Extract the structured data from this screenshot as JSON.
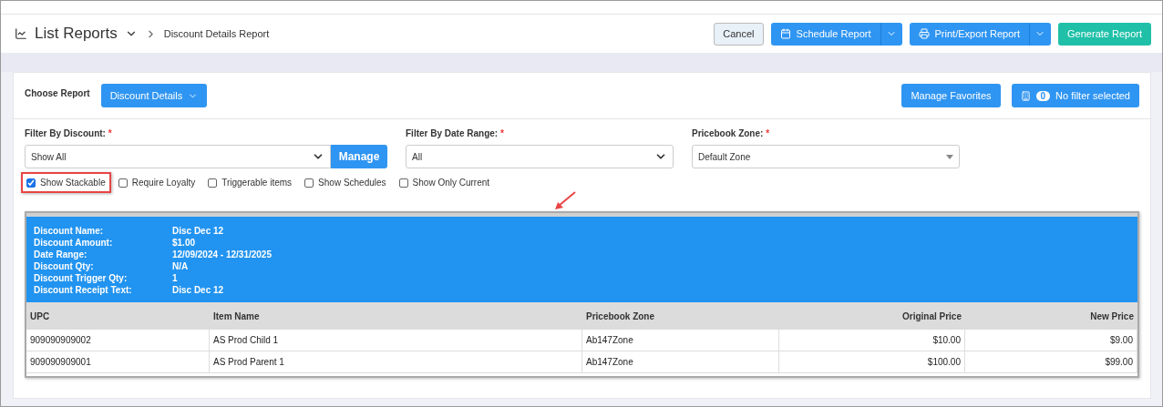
{
  "header": {
    "title": "List Reports",
    "breadcrumb": "Discount Details Report"
  },
  "actions": [
    {
      "label": "Cancel",
      "kind": "plain"
    },
    {
      "label": "Schedule Report",
      "kind": "split"
    },
    {
      "label": "Print/Export Report",
      "kind": "split"
    },
    {
      "label": "Generate Report",
      "kind": "success"
    }
  ],
  "choose_report": {
    "label": "Choose Report",
    "value": "Discount Details"
  },
  "manage_favorites": "Manage Favorites",
  "filter_badge": {
    "count": "0",
    "label": "No filter selected"
  },
  "filters": [
    {
      "label": "Filter By Discount:",
      "required": "*",
      "value": "Show All",
      "kind": "select-manage",
      "button": "Manage"
    },
    {
      "label": "Filter By Date Range:",
      "required": "*",
      "value": "All",
      "kind": "select"
    },
    {
      "label": "Pricebook Zone:",
      "required": "*",
      "value": "Default Zone",
      "kind": "combo"
    }
  ],
  "options": [
    {
      "label": "Show Stackable",
      "checked": true,
      "highlighted": true
    },
    {
      "label": "Require Loyalty",
      "checked": false,
      "highlighted": false
    },
    {
      "label": "Triggerable items",
      "checked": false,
      "highlighted": false
    },
    {
      "label": "Show Schedules",
      "checked": false,
      "highlighted": false
    },
    {
      "label": "Show Only Current",
      "checked": false,
      "highlighted": false
    }
  ],
  "summary": [
    {
      "label": "Discount Name:",
      "value": "Disc Dec 12"
    },
    {
      "label": "Discount Amount:",
      "value": "$1.00"
    },
    {
      "label": "Date Range:",
      "value": "12/09/2024 - 12/31/2025"
    },
    {
      "label": "Discount Qty:",
      "value": "N/A"
    },
    {
      "label": "Discount Trigger Qty:",
      "value": "1"
    },
    {
      "label": "Discount Receipt Text:",
      "value": "Disc Dec 12"
    }
  ],
  "table": {
    "columns": [
      "UPC",
      "Item Name",
      "Pricebook Zone",
      "Original Price",
      "New Price"
    ],
    "rows": [
      [
        "909090909002",
        "AS Prod Child 1",
        "Ab147Zone",
        "$10.00",
        "$9.00"
      ],
      [
        "909090909001",
        "AS Prod Parent 1",
        "Ab147Zone",
        "$100.00",
        "$99.00"
      ]
    ]
  }
}
